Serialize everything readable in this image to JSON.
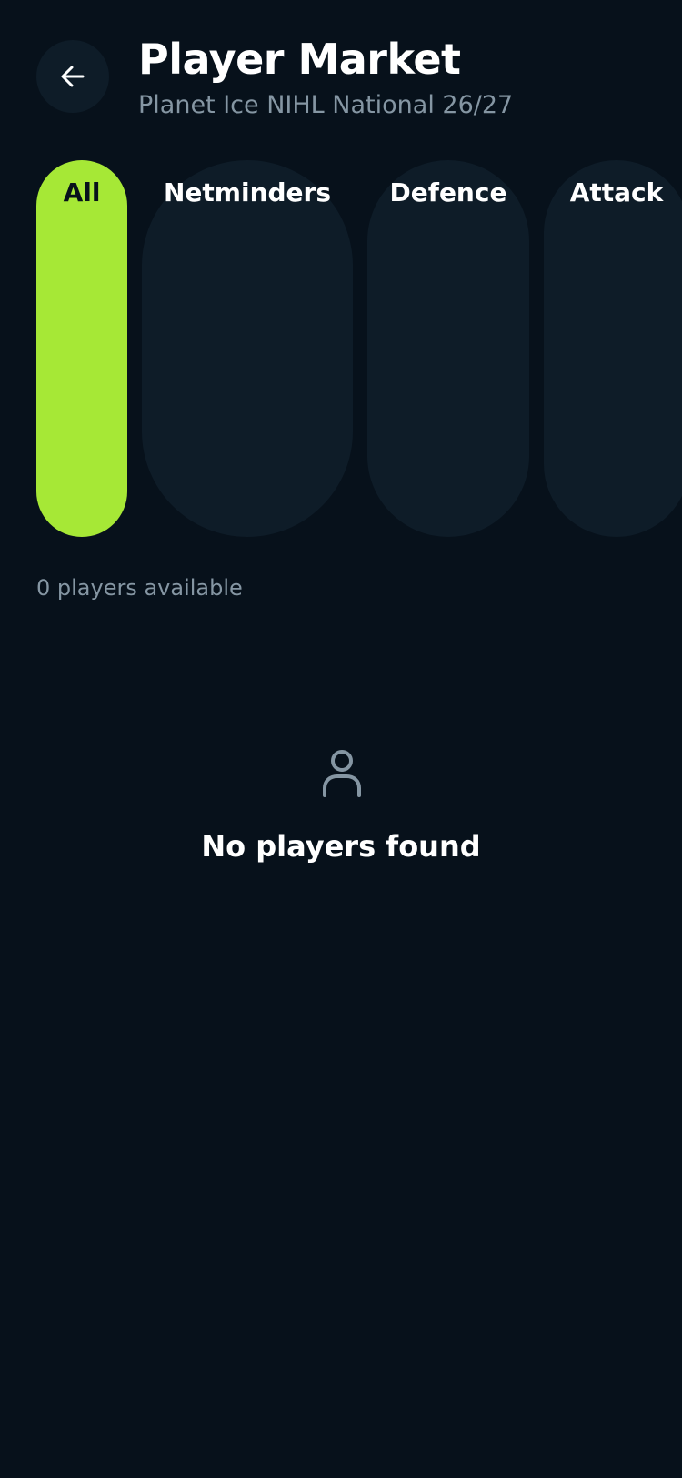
{
  "header": {
    "back_icon": "arrow-left-icon",
    "title": "Player Market",
    "subtitle": "Planet Ice NIHL National 26/27"
  },
  "filters": {
    "selected": "All",
    "items": [
      {
        "label": "All"
      },
      {
        "label": "Netminders"
      },
      {
        "label": "Defence"
      },
      {
        "label": "Attack"
      }
    ]
  },
  "summary": {
    "count_text": "0 players available"
  },
  "empty_state": {
    "icon": "user-icon",
    "title": "No players found"
  },
  "colors": {
    "background": "#07111b",
    "surface": "#0e1c28",
    "accent": "#a6e836",
    "muted_text": "#8596a3"
  }
}
